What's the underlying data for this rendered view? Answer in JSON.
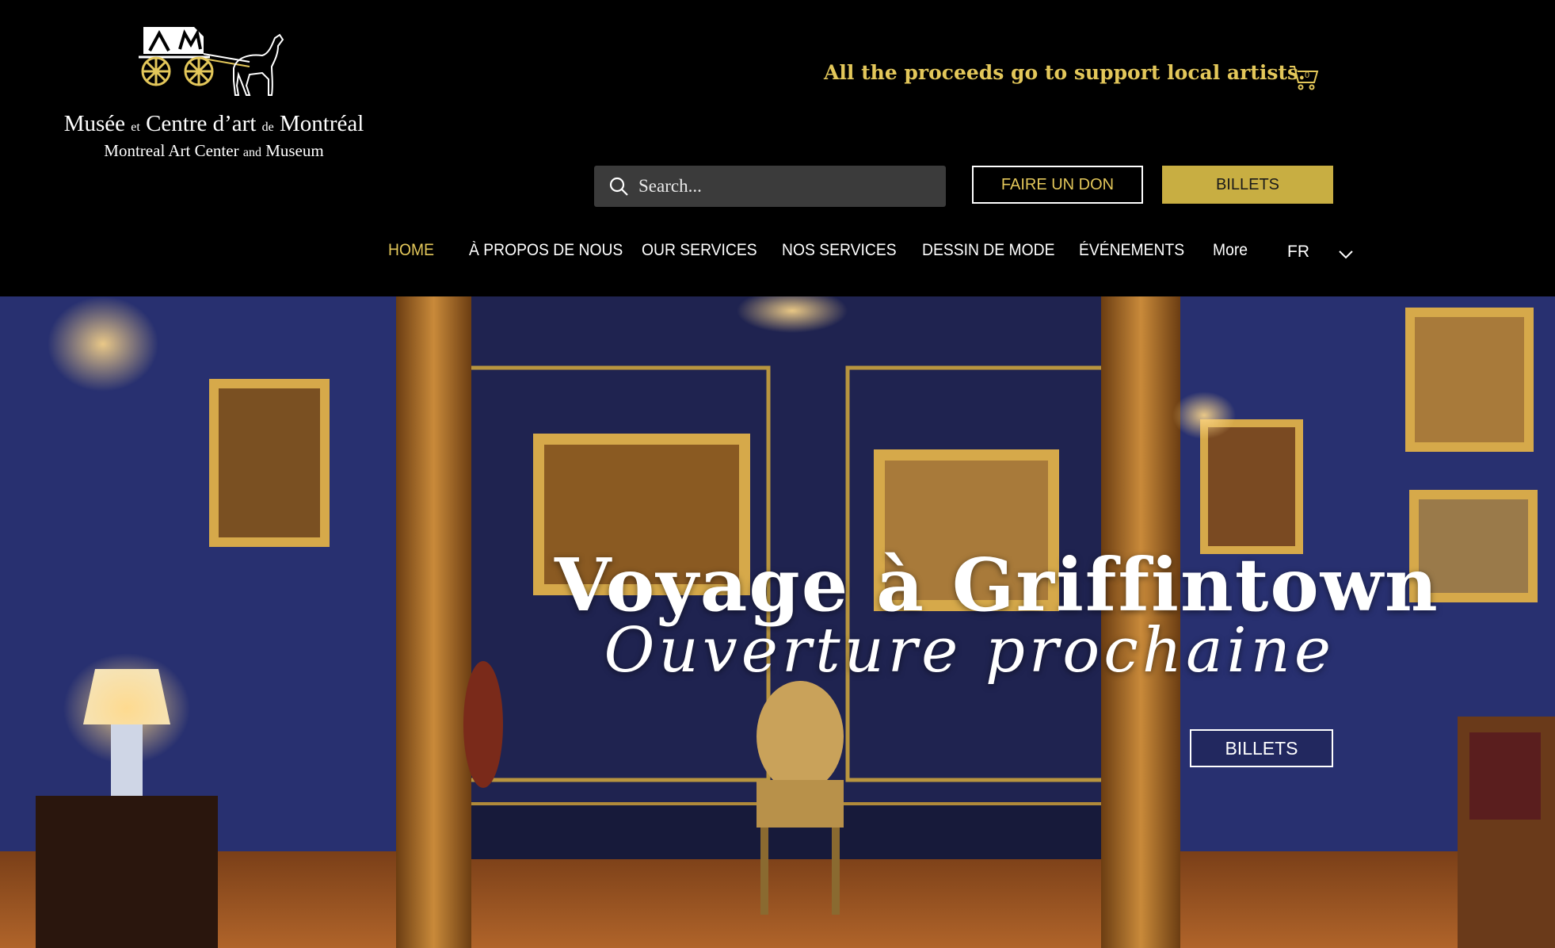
{
  "brand": {
    "name_fr_parts": [
      "Musée",
      "et",
      "Centre d’art",
      "de",
      "Montréal"
    ],
    "name_en_parts": [
      "Montreal Art Center",
      "and",
      "Museum"
    ]
  },
  "header": {
    "tagline": "All the proceeds go to support local artists.",
    "cart_count": "0",
    "search_placeholder": "Search...",
    "donate_label": "FAIRE UN DON",
    "tickets_label": "BILLETS"
  },
  "nav": {
    "items": [
      {
        "label": "HOME",
        "active": true
      },
      {
        "label": "À PROPOS DE NOUS"
      },
      {
        "label": "OUR SERVICES"
      },
      {
        "label": "NOS SERVICES"
      },
      {
        "label": "DESSIN DE MODE"
      },
      {
        "label": "ÉVÉNEMENTS"
      },
      {
        "label": "More"
      }
    ],
    "language": "FR"
  },
  "hero": {
    "title": "Voyage à Griffintown",
    "subtitle": "Ouverture prochaine",
    "tickets_label": "BILLETS"
  },
  "colors": {
    "accent_gold": "#e3c75a",
    "button_gold": "#c8ae42",
    "background": "#000000"
  },
  "icons": {
    "logo": "horse-carriage-logo",
    "cart": "cart-icon",
    "search": "search-icon",
    "language_toggle": "chevron-down-icon"
  }
}
